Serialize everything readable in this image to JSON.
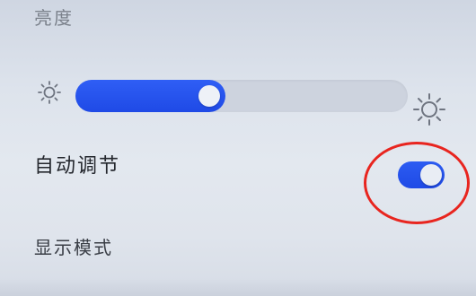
{
  "brightness": {
    "title": "亮度",
    "level_percent": 45,
    "min_icon": "sun-small-icon",
    "max_icon": "sun-large-icon"
  },
  "auto_adjust": {
    "label": "自动调节",
    "enabled": true
  },
  "display_mode": {
    "label": "显示模式"
  },
  "annotation": {
    "color": "#e8251f"
  },
  "colors": {
    "accent": "#1f4ae6"
  }
}
